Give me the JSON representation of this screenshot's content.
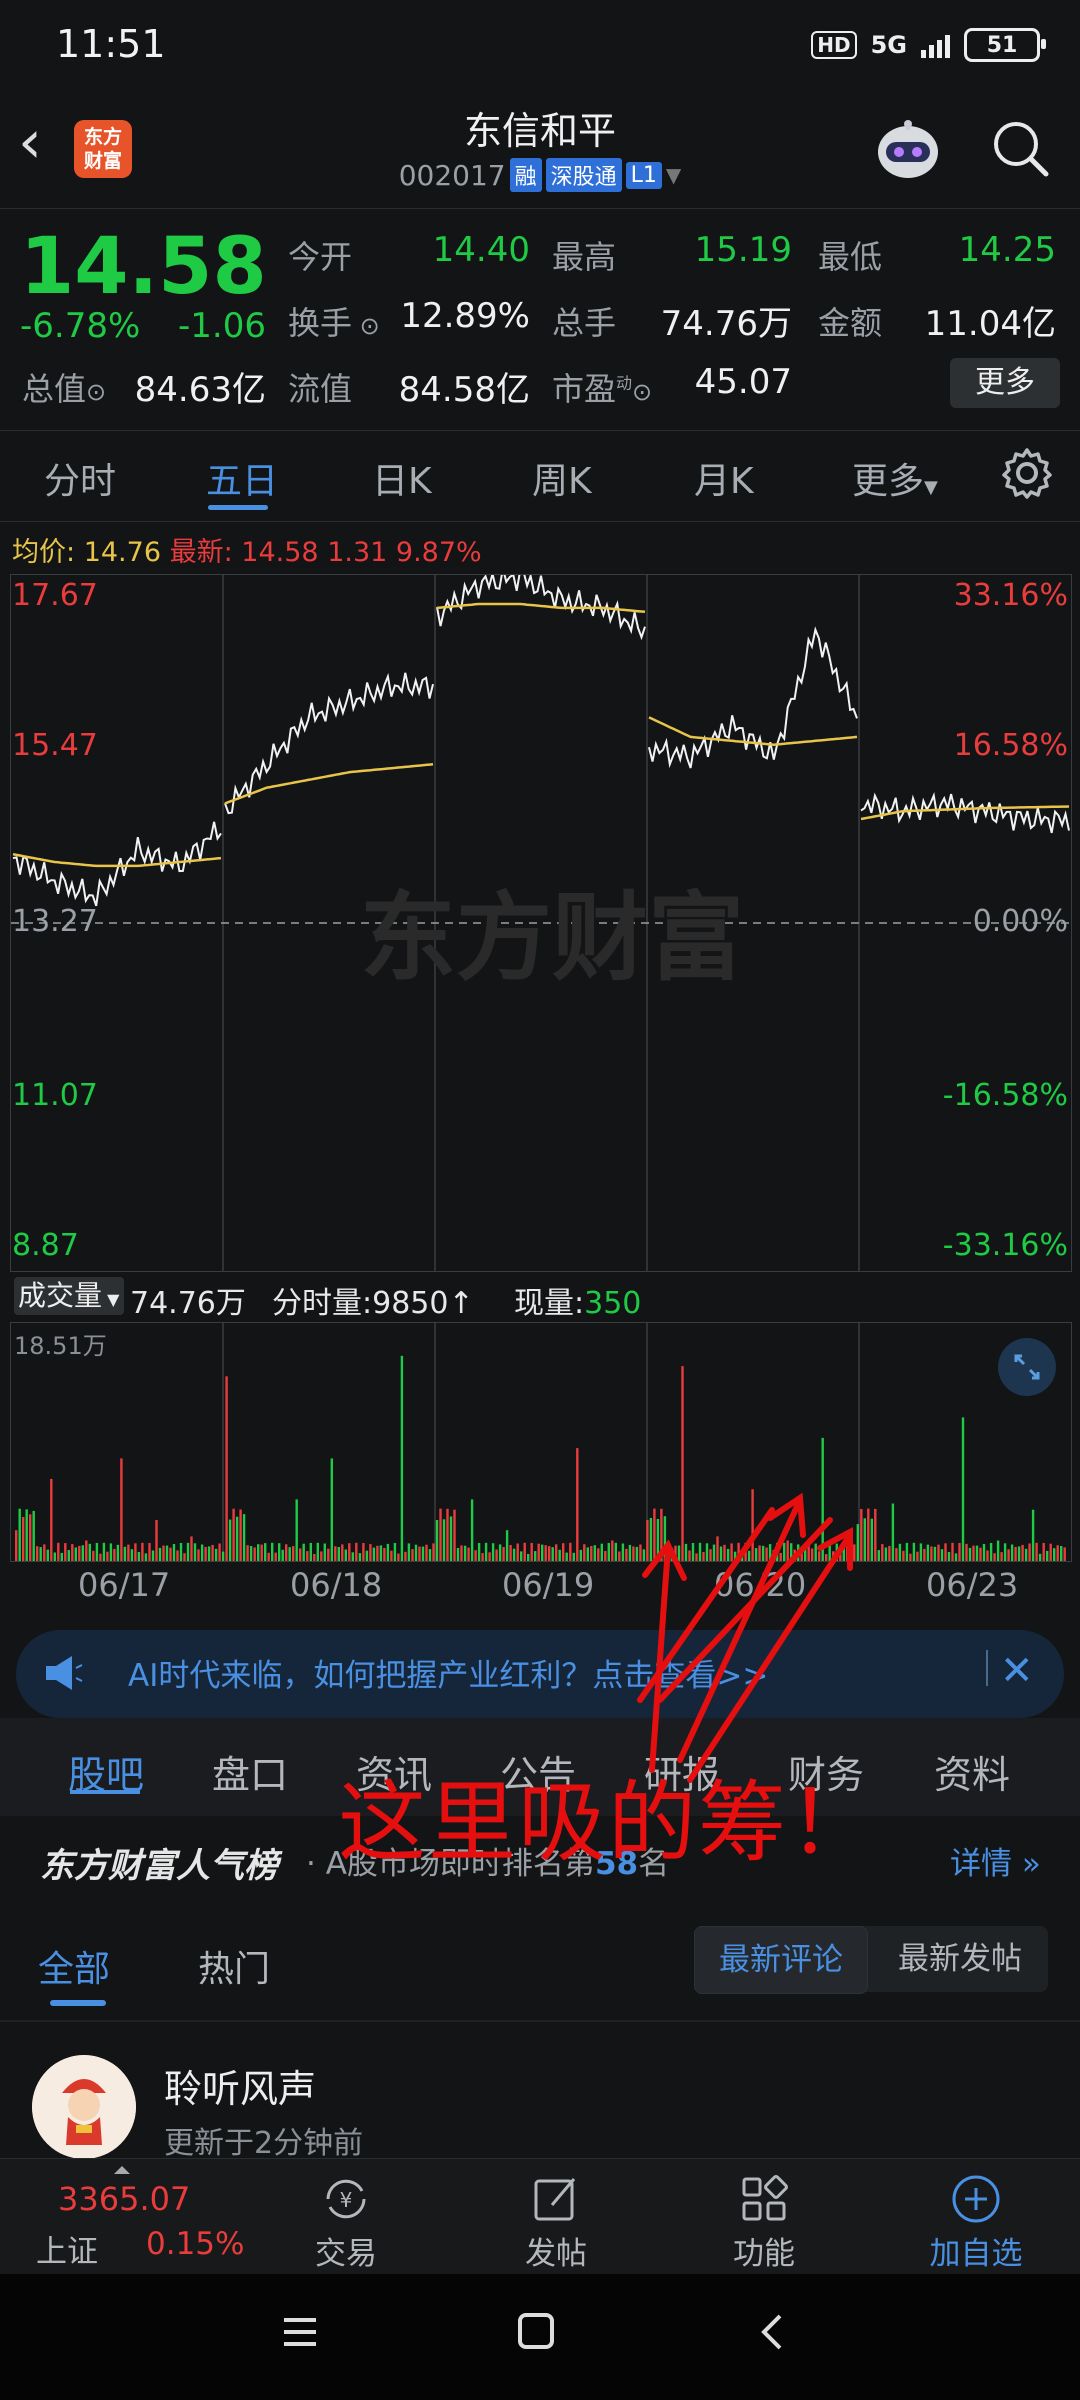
{
  "status": {
    "time": "11:51",
    "hd": "HD",
    "net": "5G",
    "battery": "51"
  },
  "header": {
    "logo_text": "东方财富",
    "title": "东信和平",
    "code": "002017",
    "tags": [
      "融",
      "深股通",
      "L1"
    ]
  },
  "quote": {
    "price": "14.58",
    "pct": "-6.78%",
    "chg": "-1.06",
    "open_label": "今开",
    "open": "14.40",
    "high_label": "最高",
    "high": "15.19",
    "low_label": "最低",
    "low": "14.25",
    "turnover_label": "换手",
    "turnover": "12.89%",
    "volume_label": "总手",
    "volume": "74.76万",
    "amount_label": "金额",
    "amount": "11.04亿",
    "mktcap_label": "总值",
    "mktcap": "84.63亿",
    "float_label": "流值",
    "float": "84.58亿",
    "pe_label": "市盈",
    "pe_sup": "动",
    "pe": "45.07",
    "more": "更多"
  },
  "tabs": [
    "分时",
    "五日",
    "日K",
    "周K",
    "月K",
    "更多"
  ],
  "chart_info": {
    "avg_label": "均价:",
    "avg": "14.76",
    "latest_label": "最新:",
    "latest": "14.58",
    "chg": "1.31",
    "pct": "9.87%",
    "watermark": "东方财富"
  },
  "chart_data": {
    "type": "line",
    "title": "",
    "yticks_left": [
      "17.67",
      "15.47",
      "13.27",
      "11.07",
      "8.87"
    ],
    "yticks_right": [
      "33.16%",
      "16.58%",
      "0.00%",
      "-16.58%",
      "-33.16%"
    ],
    "ylim": [
      8.87,
      17.67
    ],
    "baseline": 13.27,
    "x": [
      "06/17",
      "06/18",
      "06/19",
      "06/20",
      "06/23"
    ],
    "series": [
      {
        "values_per_day": [
          [
            14.1,
            13.8,
            13.6,
            14.2,
            14.0,
            14.5
          ],
          [
            14.7,
            15.3,
            15.9,
            16.1,
            16.3,
            16.3
          ],
          [
            17.2,
            17.6,
            17.7,
            17.4,
            17.3,
            17.0
          ],
          [
            15.5,
            15.4,
            15.8,
            15.4,
            17.0,
            15.9
          ],
          [
            14.8,
            14.7,
            14.8,
            14.7,
            14.6,
            14.58
          ]
        ]
      },
      {
        "values_per_day": [
          [
            14.15,
            14.05,
            14.0,
            14.0,
            14.05,
            14.1
          ],
          [
            14.8,
            15.0,
            15.1,
            15.2,
            15.25,
            15.3
          ],
          [
            17.3,
            17.35,
            17.35,
            17.3,
            17.3,
            17.25
          ],
          [
            15.9,
            15.65,
            15.6,
            15.55,
            15.6,
            15.65
          ],
          [
            14.6,
            14.7,
            14.72,
            14.74,
            14.75,
            14.76
          ]
        ]
      }
    ]
  },
  "volume": {
    "selector": "成交量",
    "total": "74.76万",
    "tick_label": "分时量:",
    "tick": "9850",
    "now_label": "现量:",
    "now": "350",
    "max": "18.51万",
    "bars": [
      0.15,
      0.4,
      0.1,
      0.5,
      0.2,
      0.12,
      0.9,
      0.08,
      0.3,
      0.5,
      0.05,
      1.0,
      0.2,
      0.3,
      0.15,
      0.08,
      0.55,
      0.1,
      0.2,
      0.95,
      0.12,
      0.35,
      0.1,
      0.6,
      0.18,
      0.28,
      0.08,
      0.7,
      0.1,
      0.25
    ]
  },
  "banner": {
    "text": "AI时代来临，如何把握产业红利？点击查看>>"
  },
  "section_tabs": [
    "股吧",
    "盘口",
    "资讯",
    "公告",
    "研报",
    "财务",
    "资料"
  ],
  "rank": {
    "title": "东方财富人气榜",
    "text_prefix": "A股市场即时排名第",
    "rank": "58",
    "text_suffix": "名",
    "detail": "详情"
  },
  "filter_tabs": [
    "全部",
    "热门"
  ],
  "sort_tabs": [
    "最新评论",
    "最新发帖"
  ],
  "post": {
    "name": "聆听风声",
    "time": "更新于2分钟前"
  },
  "bottom_nav": {
    "index_val": "3365.07",
    "index_name": "上证",
    "index_pct": "0.15%",
    "items": [
      "交易",
      "发帖",
      "功能",
      "加自选"
    ]
  },
  "annotation": "这里吸的筹！"
}
